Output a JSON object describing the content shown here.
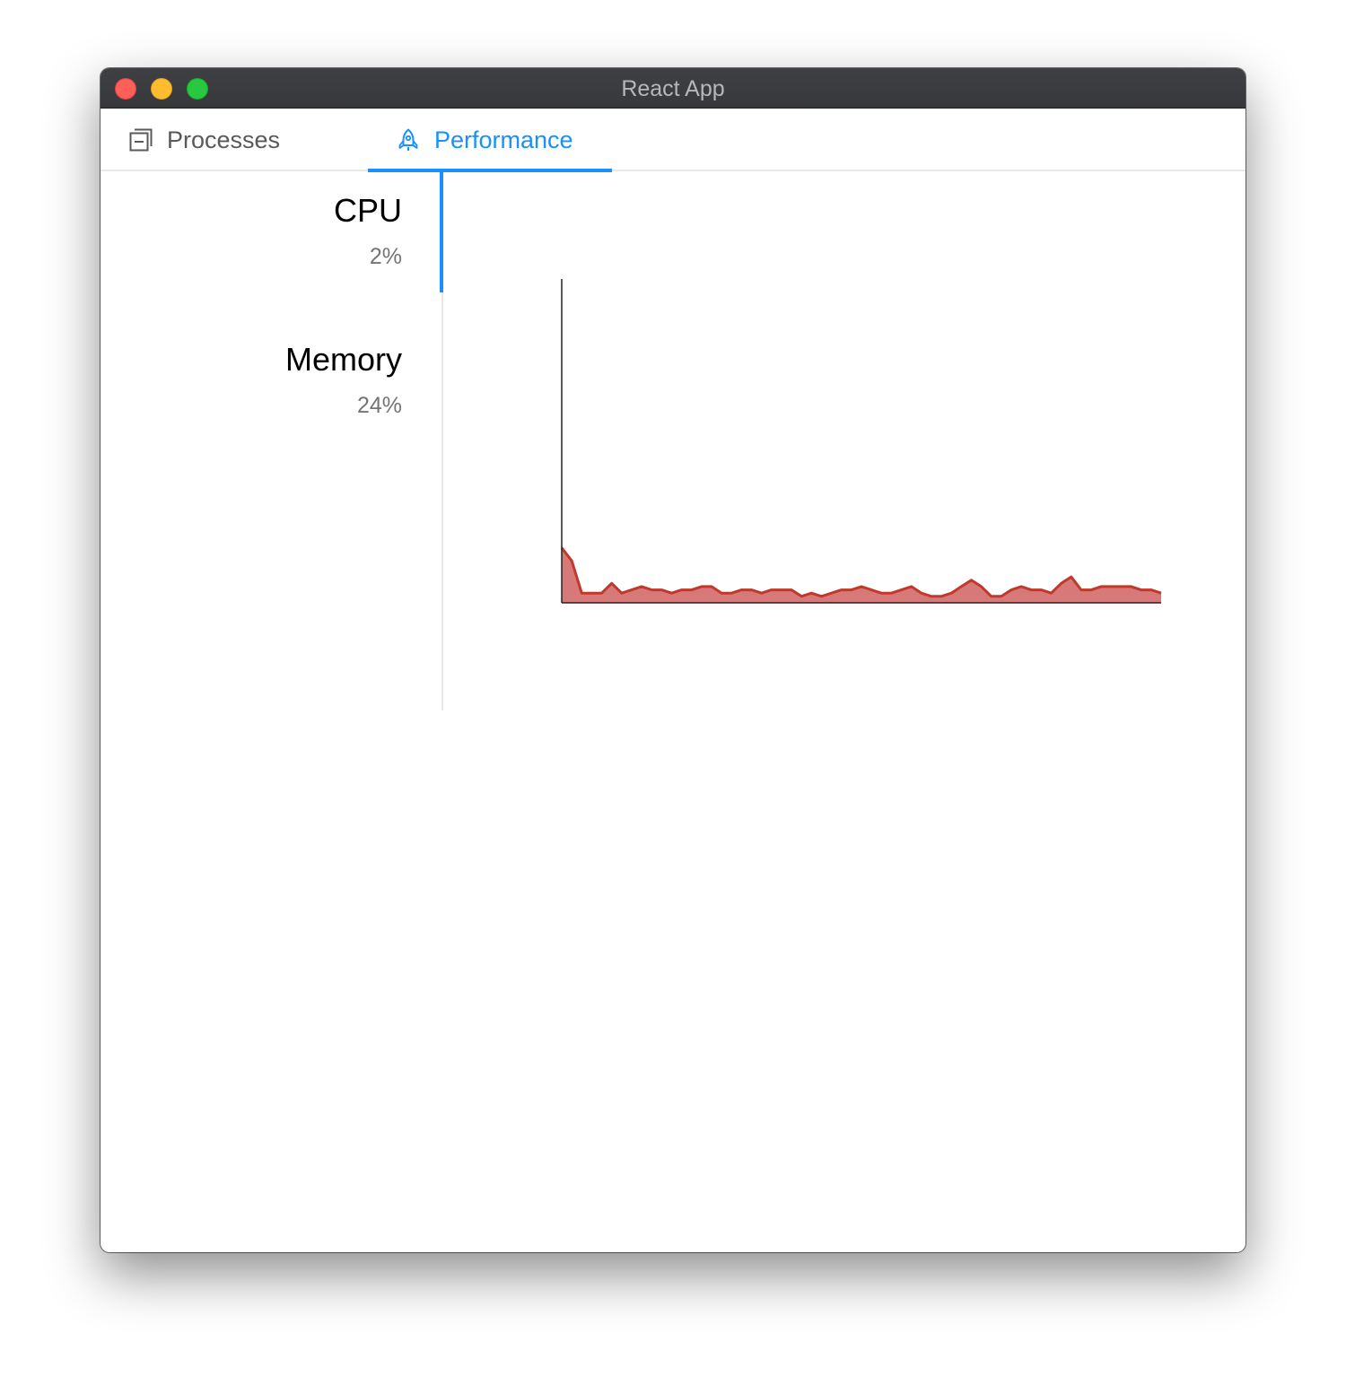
{
  "window": {
    "title": "React App"
  },
  "tabs": [
    {
      "label": "Processes",
      "icon": "window-restore-icon",
      "active": false
    },
    {
      "label": "Performance",
      "icon": "rocket-icon",
      "active": true
    }
  ],
  "side_menu": {
    "items": [
      {
        "name": "CPU",
        "value": "2%",
        "active": true
      },
      {
        "name": "Memory",
        "value": "24%",
        "active": false
      }
    ]
  },
  "colors": {
    "accent": "#1890ff",
    "chart_line": "#c0392b",
    "chart_fill": "#d46a6a"
  },
  "chart_data": {
    "type": "area",
    "title": "",
    "xlabel": "",
    "ylabel": "",
    "ylim": [
      0,
      100
    ],
    "grid": false,
    "values": [
      17,
      13,
      3,
      3,
      3,
      6,
      3,
      4,
      5,
      4,
      4,
      3,
      4,
      4,
      5,
      5,
      3,
      3,
      4,
      4,
      3,
      4,
      4,
      4,
      2,
      3,
      2,
      3,
      4,
      4,
      5,
      4,
      3,
      3,
      4,
      5,
      3,
      2,
      2,
      3,
      5,
      7,
      5,
      2,
      2,
      4,
      5,
      4,
      4,
      3,
      6,
      8,
      4,
      4,
      5,
      5,
      5,
      5,
      4,
      4,
      3
    ]
  }
}
